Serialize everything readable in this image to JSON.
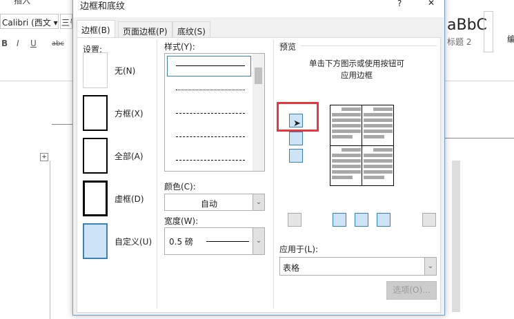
{
  "word": {
    "tab_insert": "插入",
    "font_name": "Calibri (西文",
    "font_size": "三号",
    "bold": "B",
    "italic": "I",
    "underline": "U",
    "strike": "abc",
    "style_preview": "aBbC",
    "style_name": "标题 2",
    "edit": "编"
  },
  "dialog": {
    "title": "边框和底纹",
    "help": "?",
    "close": "✕",
    "tabs": [
      "边框(B)",
      "页面边框(P)",
      "底纹(S)"
    ],
    "settings_label": "设置:",
    "settings": [
      "无(N)",
      "方框(X)",
      "全部(A)",
      "虚框(D)",
      "自定义(U)"
    ],
    "style_label": "样式(Y):",
    "color_label": "颜色(C):",
    "color_value": "自动",
    "width_label": "宽度(W):",
    "width_value": "0.5 磅",
    "preview_label": "预览",
    "preview_hint_1": "单击下方图示或使用按钮可",
    "preview_hint_2": "应用边框",
    "apply_label": "应用于(L):",
    "apply_value": "表格",
    "options_button": "选项(O)...",
    "highlight_color": "#e8363d"
  }
}
